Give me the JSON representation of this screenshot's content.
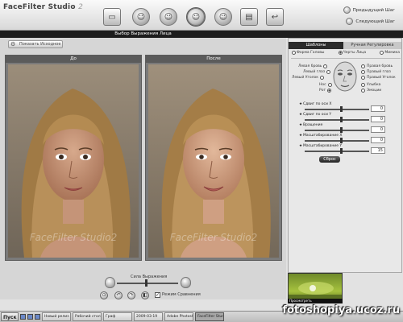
{
  "app": {
    "title": "FaceFilter Studio",
    "version": "2"
  },
  "toolbar": {
    "icons": [
      "folder-icon",
      "face-icon",
      "face-icon",
      "face-icon",
      "face-icon",
      "print-icon",
      "export-icon"
    ],
    "next_step": "Следующий Шаг",
    "prev_step": "Предыдущий Шаг"
  },
  "section_title": "Выбор Выражения Лица",
  "show_original": "Показать Исходное",
  "panels": {
    "before": "До",
    "after": "После"
  },
  "watermark": "FaceFilter Studio2",
  "smile": {
    "label": "Сила Выражения",
    "checkbox_label": "Режим Сравнения"
  },
  "right_panel": {
    "tab_active": "Шаблоны",
    "tab_inactive": "Ручная Регулировка",
    "radios": [
      {
        "label": "Форма Головы",
        "on": false
      },
      {
        "label": "Черты Лица",
        "on": true
      },
      {
        "label": "Мимика",
        "on": false
      }
    ],
    "options_left": [
      "Левая бровь",
      "Левый глаз",
      "Левый Уголок",
      "Нос",
      "Рот"
    ],
    "options_right": [
      "Правая бровь",
      "Правый глаз",
      "Правый Уголок",
      "Улыбка",
      "Эмоции"
    ],
    "params": [
      {
        "label": "Сдвиг по оси X",
        "value": "0",
        "level": 0.55
      },
      {
        "label": "Сдвиг по оси Y",
        "value": "0",
        "level": 0.55
      },
      {
        "label": "Вращение",
        "value": "0",
        "level": 0.55
      },
      {
        "label": "Масштабирование X",
        "value": "0",
        "level": 0.55
      },
      {
        "label": "Масштабирование Y",
        "value": "15",
        "level": 0.55
      }
    ],
    "reset": "Сброс"
  },
  "preview_label": "Просмотреть",
  "taskbar": {
    "start": "Пуск",
    "tasks": [
      "Новый релиз",
      "Рабочий стол",
      "Граф",
      "2009-03-19",
      "Adobe Photoshop",
      "FaceFilter Studio"
    ],
    "active_index": 5
  },
  "site_watermark": "fotoshopiya.ucoz.ru"
}
